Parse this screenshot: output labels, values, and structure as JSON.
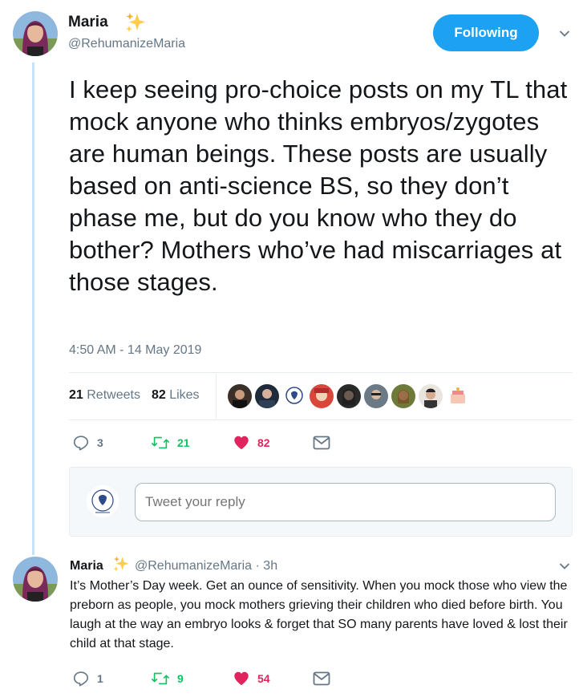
{
  "tweet": {
    "author_name": "Maria",
    "author_handle": "@RehumanizeMaria",
    "follow_label": "Following",
    "text": "I keep seeing pro-choice posts on my TL that mock anyone who thinks embryos/zygotes are human beings. These posts are usually based on anti-science BS, so they don’t phase me, but do you know who they do bother? Mothers who’ve had miscarriages at those stages.",
    "timestamp": "4:50 AM - 14 May 2019",
    "retweets_count": "21",
    "retweets_label": "Retweets",
    "likes_count": "82",
    "likes_label": "Likes",
    "reply_count": "3",
    "retweet_count": "21",
    "like_count": "82"
  },
  "reply_box": {
    "placeholder": "Tweet your reply"
  },
  "reply": {
    "author_name": "Maria",
    "author_handle": "@RehumanizeMaria · 3h",
    "text": "It’s Mother’s Day week. Get an ounce of sensitivity. When you mock those who view the preborn as people, you mock mothers grieving their children who died before birth. You laugh at the way an embryo looks & forget that SO many parents have loved & lost their child at that stage.",
    "reply_count": "1",
    "retweet_count": "9",
    "like_count": "54"
  },
  "colors": {
    "accent": "#1da1f2",
    "retweet": "#17bf63",
    "like": "#e0245e",
    "muted": "#657786"
  },
  "icons": [
    "sparkle-icon",
    "chevron-down-icon",
    "reply-icon",
    "retweet-icon",
    "heart-icon",
    "envelope-icon"
  ]
}
